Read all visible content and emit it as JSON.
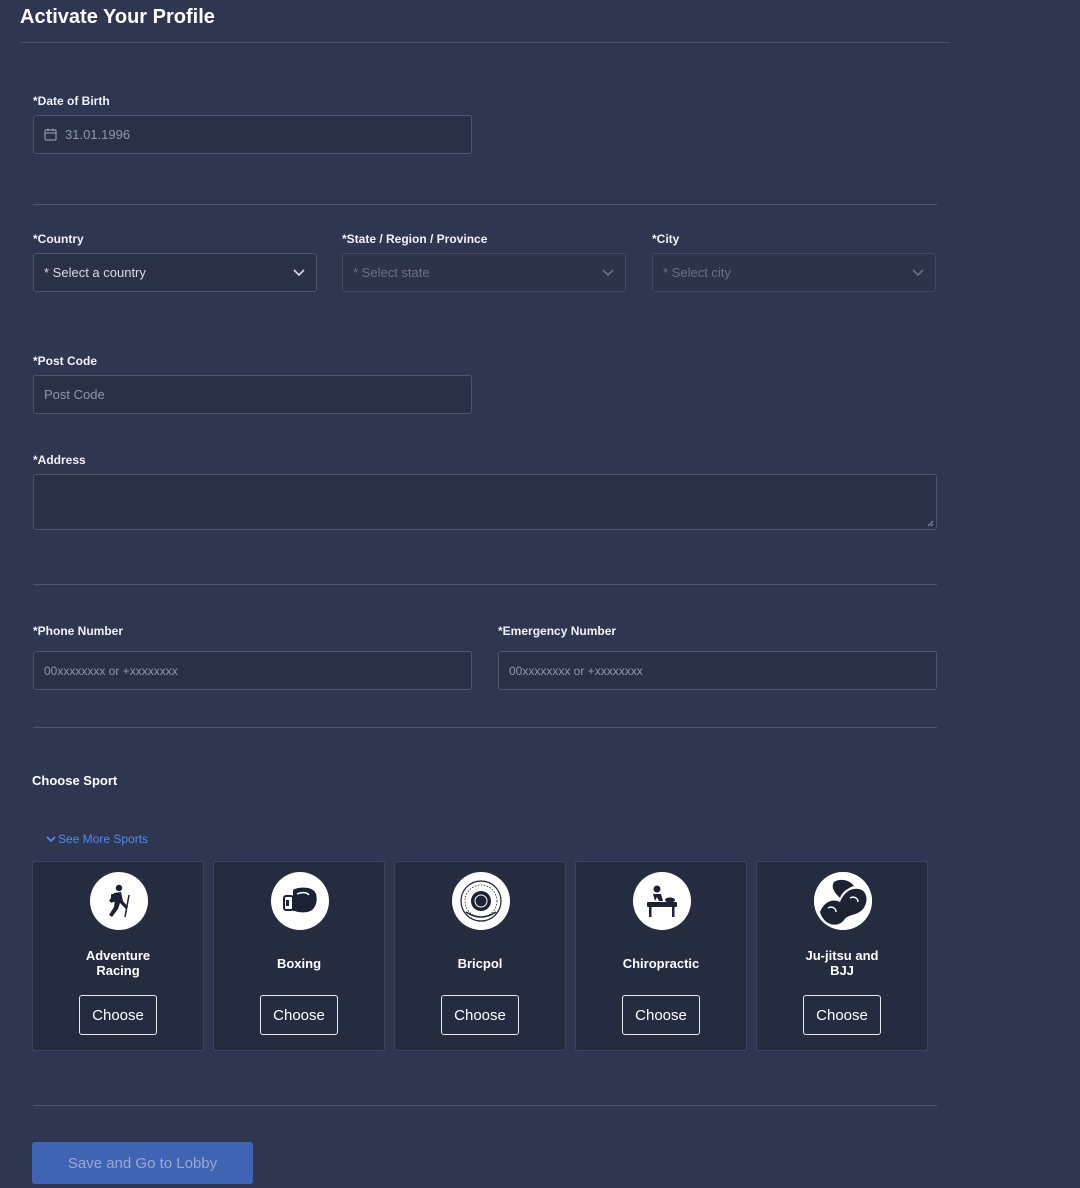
{
  "page": {
    "title": "Activate Your Profile"
  },
  "dob": {
    "label": "*Date of Birth",
    "value": "31.01.1996",
    "icon": "calendar-icon"
  },
  "country": {
    "label": "*Country",
    "value": "* Select a country"
  },
  "state": {
    "label": "*State / Region / Province",
    "value": "* Select state"
  },
  "city": {
    "label": "*City",
    "value": "* Select city"
  },
  "postcode": {
    "label": "*Post Code",
    "placeholder": "Post Code"
  },
  "address": {
    "label": "*Address"
  },
  "phone": {
    "label": "*Phone Number",
    "placeholder": "00xxxxxxxx or +xxxxxxxx"
  },
  "emergency": {
    "label": "*Emergency Number",
    "placeholder": "00xxxxxxxx or +xxxxxxxx"
  },
  "sports": {
    "title": "Choose Sport",
    "see_more": "See More Sports",
    "choose_label": "Choose",
    "items": [
      {
        "name": "Adventure Racing",
        "icon": "hiker-icon"
      },
      {
        "name": "Boxing",
        "icon": "boxing-glove-icon"
      },
      {
        "name": "Bricpol",
        "icon": "emblem-icon"
      },
      {
        "name": "Chiropractic",
        "icon": "massage-table-icon"
      },
      {
        "name": "Ju-jitsu and BJJ",
        "icon": "grappling-icon"
      }
    ]
  },
  "footer": {
    "save_label": "Save and Go to Lobby"
  },
  "colors": {
    "background": "#2f3650",
    "field": "#2a3046",
    "accent": "#4b8ef0",
    "save_button": "#3f64b4"
  }
}
